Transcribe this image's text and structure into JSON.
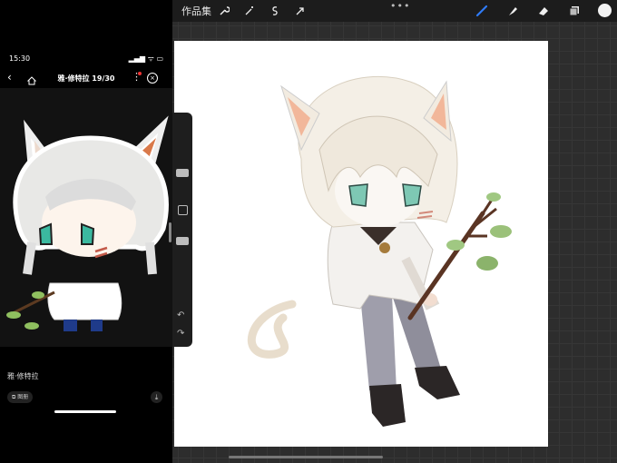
{
  "toolbar": {
    "gallery_label": "作品集",
    "tools": [
      "wrench-icon",
      "magic-wand-icon",
      "selection-icon",
      "transform-arrow-icon"
    ],
    "right_tools": [
      "brush-icon",
      "smudge-icon",
      "eraser-icon",
      "layers-icon"
    ],
    "active_tool": "brush",
    "current_color": "#f2f2f2",
    "accent": "#2f7bf6"
  },
  "phone": {
    "time": "15:30",
    "status_icons": "▂▄▆ ᯤ ▭",
    "title": "雅·修特拉 19/30",
    "caption": "雅·修特拉",
    "chip_label": "图册",
    "download_icon": "download-icon"
  },
  "sidebar": {
    "undo_icon": "undo-icon",
    "redo_icon": "redo-icon",
    "modify_icon": "square-icon"
  }
}
